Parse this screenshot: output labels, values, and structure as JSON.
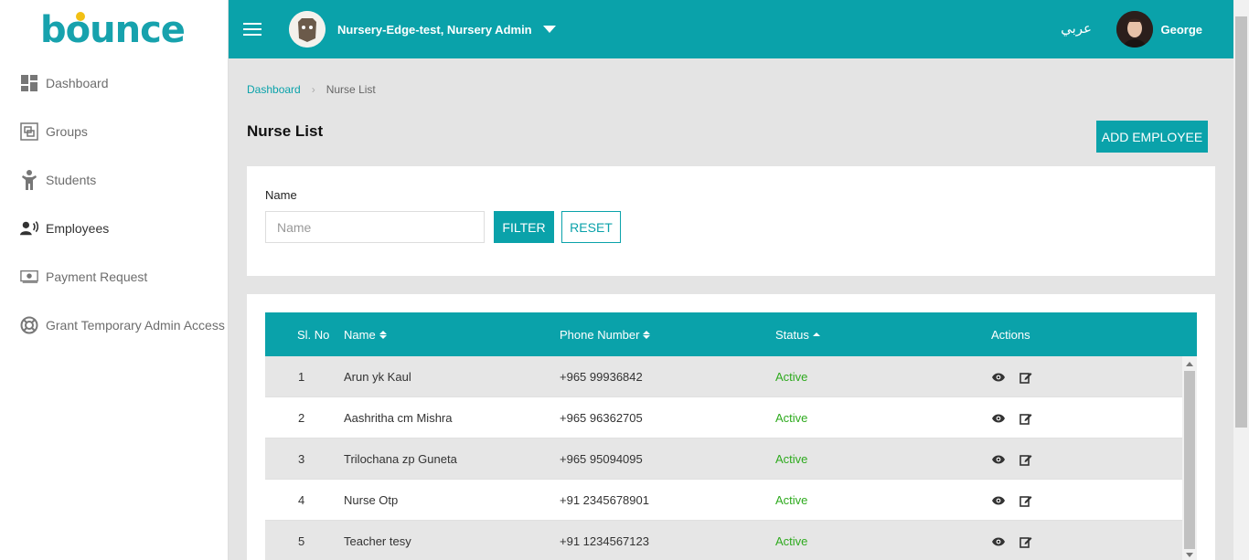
{
  "app": {
    "logo_text": "bounce"
  },
  "sidebar": {
    "items": [
      {
        "label": "Dashboard",
        "icon": "dashboard-icon"
      },
      {
        "label": "Groups",
        "icon": "groups-icon"
      },
      {
        "label": "Students",
        "icon": "student-icon"
      },
      {
        "label": "Employees",
        "icon": "employees-icon",
        "active": true
      },
      {
        "label": "Payment Request",
        "icon": "payment-icon"
      },
      {
        "label": "Grant Temporary Admin Access",
        "icon": "lifebuoy-icon"
      }
    ]
  },
  "topbar": {
    "school_name": "Nursery-Edge-test, Nursery Admin",
    "language": "عربي",
    "user_name": "George"
  },
  "breadcrumb": {
    "home": "Dashboard",
    "current": "Nurse List"
  },
  "page": {
    "title": "Nurse List",
    "add_button": "ADD EMPLOYEE"
  },
  "filter": {
    "label": "Name",
    "placeholder": "Name",
    "value": "",
    "filter_button": "FILTER",
    "reset_button": "RESET"
  },
  "table": {
    "columns": [
      "Sl. No",
      "Name",
      "Phone Number",
      "Status",
      "Actions"
    ],
    "rows": [
      {
        "no": "1",
        "name": "Arun yk Kaul",
        "phone": "+965 99936842",
        "status": "Active"
      },
      {
        "no": "2",
        "name": "Aashritha cm Mishra",
        "phone": "+965 96362705",
        "status": "Active"
      },
      {
        "no": "3",
        "name": "Trilochana zp Guneta",
        "phone": "+965 95094095",
        "status": "Active"
      },
      {
        "no": "4",
        "name": "Nurse Otp",
        "phone": "+91 2345678901",
        "status": "Active"
      },
      {
        "no": "5",
        "name": "Teacher tesy",
        "phone": "+91 1234567123",
        "status": "Active"
      }
    ]
  },
  "colors": {
    "accent": "#0aa2aa",
    "active_status": "#2eaa1e"
  }
}
